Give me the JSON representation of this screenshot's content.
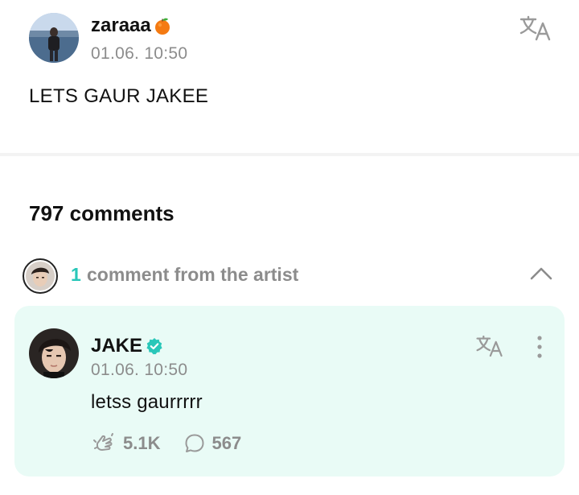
{
  "post": {
    "author": "zaraaa",
    "author_emoji": "orange-emoji",
    "timestamp": "01.06. 10:50",
    "text": "LETS GAUR JAKEE",
    "translate_icon": "translate-icon"
  },
  "comments": {
    "count_label": "797 comments"
  },
  "artist_section": {
    "count": "1",
    "label": "comment from the artist",
    "toggle_icon": "chevron-up-icon"
  },
  "artist_comment": {
    "author": "JAKE",
    "verified_icon": "verified-badge-icon",
    "timestamp": "01.06. 10:50",
    "text": "letss gaurrrrr",
    "likes": "5.1K",
    "replies": "567",
    "accent_color": "#29c7b9",
    "card_color": "#e9fbf6"
  }
}
